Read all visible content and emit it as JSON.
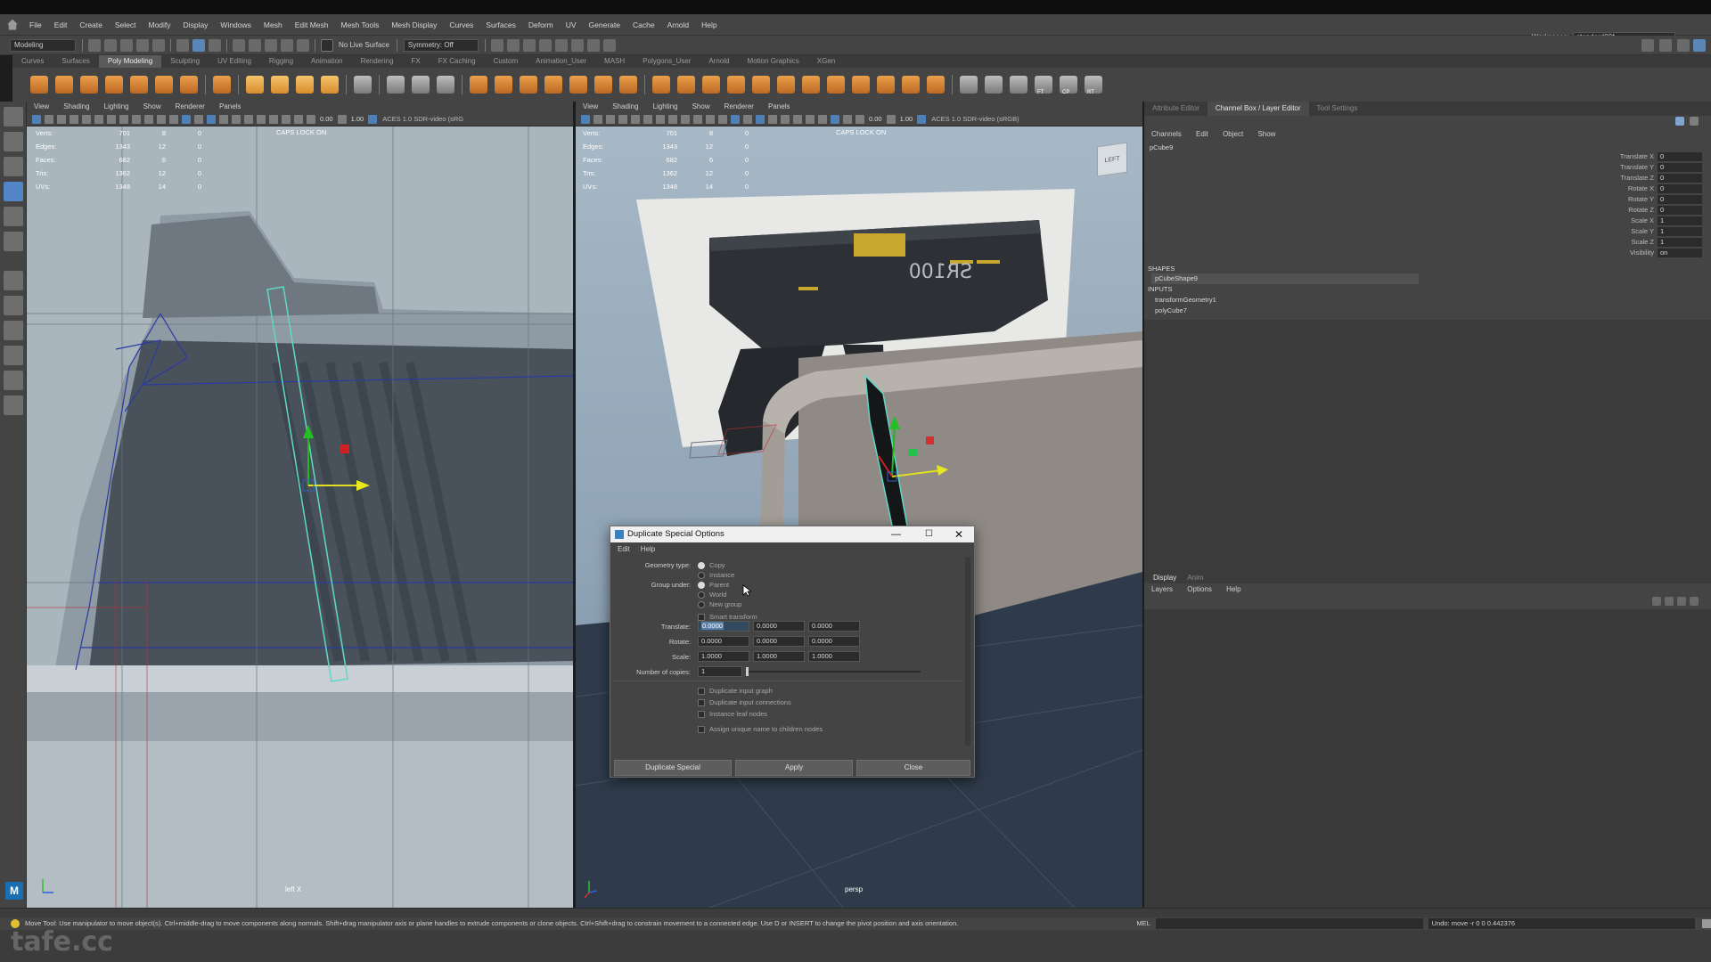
{
  "menubar": {
    "items": [
      "File",
      "Edit",
      "Create",
      "Select",
      "Modify",
      "Display",
      "Windows",
      "Mesh",
      "Edit Mesh",
      "Mesh Tools",
      "Mesh Display",
      "Curves",
      "Surfaces",
      "Deform",
      "UV",
      "Generate",
      "Cache",
      "Arnold",
      "Help"
    ],
    "workspace_label": "Workspace:",
    "workspace_value": "standard00*"
  },
  "statusline": {
    "mode": "Modeling",
    "live_surface": "No Live Surface",
    "symmetry": "Symmetry: Off"
  },
  "shelf": {
    "tabs": [
      "Curves",
      "Surfaces",
      "Poly Modeling",
      "Sculpting",
      "UV Editing",
      "Rigging",
      "Animation",
      "Rendering",
      "FX",
      "FX Caching",
      "Custom",
      "Animation_User",
      "MASH",
      "Polygons_User",
      "Arnold",
      "Motion Graphics",
      "XGen"
    ],
    "active_tab": "Poly Modeling",
    "icon_labels": [
      "FT",
      "CP",
      "RT"
    ]
  },
  "viewport_left": {
    "menu": [
      "View",
      "Shading",
      "Lighting",
      "Show",
      "Renderer",
      "Panels"
    ],
    "exposure": "0.00",
    "gamma": "1.00",
    "color_space": "ACES 1.0 SDR-video (sRG",
    "hud": [
      {
        "label": "Verts:",
        "v1": "701",
        "v2": "8",
        "v3": "0"
      },
      {
        "label": "Edges:",
        "v1": "1343",
        "v2": "12",
        "v3": "0"
      },
      {
        "label": "Faces:",
        "v1": "682",
        "v2": "6",
        "v3": "0"
      },
      {
        "label": "Tris:",
        "v1": "1362",
        "v2": "12",
        "v3": "0"
      },
      {
        "label": "UVs:",
        "v1": "1348",
        "v2": "14",
        "v3": "0"
      }
    ],
    "caps": "CAPS LOCK ON",
    "name": "left X"
  },
  "viewport_right": {
    "menu": [
      "View",
      "Shading",
      "Lighting",
      "Show",
      "Renderer",
      "Panels"
    ],
    "exposure": "0.00",
    "gamma": "1.00",
    "color_space": "ACES 1.0 SDR-video (sRGB)",
    "hud": [
      {
        "label": "Verts:",
        "v1": "701",
        "v2": "8",
        "v3": "0"
      },
      {
        "label": "Edges:",
        "v1": "1343",
        "v2": "12",
        "v3": "0"
      },
      {
        "label": "Faces:",
        "v1": "682",
        "v2": "6",
        "v3": "0"
      },
      {
        "label": "Tris:",
        "v1": "1362",
        "v2": "12",
        "v3": "0"
      },
      {
        "label": "UVs:",
        "v1": "1348",
        "v2": "14",
        "v3": "0"
      }
    ],
    "caps": "CAPS LOCK ON",
    "name": "persp",
    "viewcube_label": "LEFT",
    "slide_text": "SR100"
  },
  "right_panel": {
    "tabs": [
      "Attribute Editor",
      "Channel Box / Layer Editor",
      "Tool Settings"
    ],
    "active_tab": "Channel Box / Layer Editor",
    "menu": [
      "Channels",
      "Edit",
      "Object",
      "Show"
    ],
    "object": "pCube9",
    "attributes": [
      {
        "name": "Translate X",
        "value": "0"
      },
      {
        "name": "Translate Y",
        "value": "0"
      },
      {
        "name": "Translate Z",
        "value": "0"
      },
      {
        "name": "Rotate X",
        "value": "0"
      },
      {
        "name": "Rotate Y",
        "value": "0"
      },
      {
        "name": "Rotate Z",
        "value": "0"
      },
      {
        "name": "Scale X",
        "value": "1"
      },
      {
        "name": "Scale Y",
        "value": "1"
      },
      {
        "name": "Scale Z",
        "value": "1"
      },
      {
        "name": "Visibility",
        "value": "on"
      }
    ],
    "shapes_header": "SHAPES",
    "shape": "pCubeShape9",
    "inputs_header": "INPUTS",
    "inputs": [
      "transformGeometry1",
      "polyCube7"
    ],
    "layer_tabs": [
      "Display",
      "Anim"
    ],
    "layer_menu": [
      "Layers",
      "Options",
      "Help"
    ]
  },
  "dialog": {
    "title": "Duplicate Special Options",
    "menu": [
      "Edit",
      "Help"
    ],
    "geometry_type_label": "Geometry type:",
    "geometry_options": [
      "Copy",
      "Instance"
    ],
    "group_under_label": "Group under:",
    "group_options": [
      "Parent",
      "World",
      "New group"
    ],
    "smart_transform": "Smart transform",
    "translate_label": "Translate:",
    "translate": [
      "0.0000",
      "0.0000",
      "0.0000"
    ],
    "rotate_label": "Rotate:",
    "rotate": [
      "0.0000",
      "0.0000",
      "0.0000"
    ],
    "scale_label": "Scale:",
    "scale": [
      "1.0000",
      "1.0000",
      "1.0000"
    ],
    "copies_label": "Number of copies:",
    "copies": "1",
    "checkboxes": [
      "Duplicate input graph",
      "Duplicate input connections",
      "Instance leaf nodes",
      "Assign unique name to children nodes"
    ],
    "buttons": [
      "Duplicate Special",
      "Apply",
      "Close"
    ]
  },
  "helpline": {
    "text": "Move Tool: Use manipulator to move object(s). Ctrl+middle-drag to move components along normals. Shift+drag manipulator axis or plane handles to extrude components or clone objects. Ctrl+Shift+drag to constrain movement to a connected edge. Use D or INSERT to change the pivot position and axis orientation.",
    "mel": "MEL",
    "result": "Undo: move -r 0 0 0.442376"
  },
  "watermark": "tafe.cc"
}
